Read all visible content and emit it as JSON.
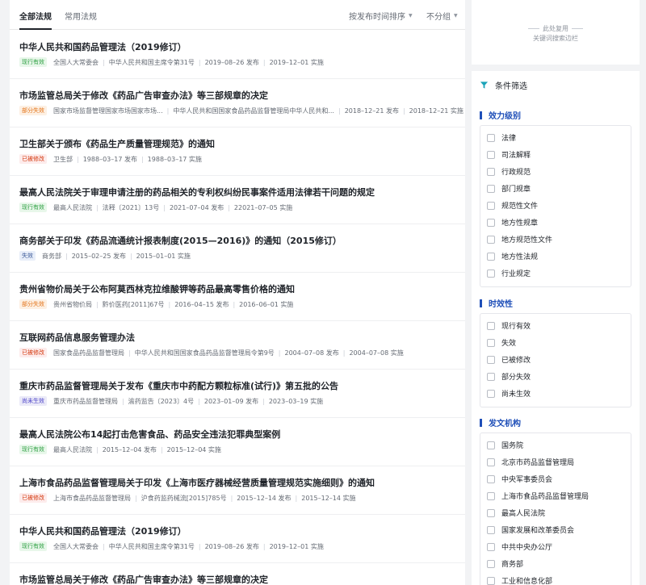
{
  "tabs": [
    {
      "label": "全部法规"
    },
    {
      "label": "常用法规"
    }
  ],
  "sort": {
    "time_label": "按发布时间排序",
    "group_label": "不分组"
  },
  "items": [
    {
      "title": "中华人民共和国药品管理法（2019修订）",
      "badge": "现行有效",
      "status": "valid",
      "meta": [
        "全国人大常委会",
        "中华人民共和国主席令第31号",
        "2019–08–26 发布",
        "2019–12–01 实施"
      ]
    },
    {
      "title": "市场监管总局关于修改《药品广告审查办法》等三部规章的决定",
      "badge": "部分失效",
      "status": "partial",
      "meta": [
        "国家市场监督管理国家市场国家市场...",
        "中华人民共和国国家食品药品监督管理局中华人民共和...",
        "2018–12–21 发布",
        "2018–12–21 实施"
      ]
    },
    {
      "title": "卫生部关于颁布《药品生产质量管理规范》的通知",
      "badge": "已被修改",
      "status": "amended",
      "meta": [
        "卫生部",
        "1988–03–17 发布",
        "1988–03–17 实施"
      ]
    },
    {
      "title": "最高人民法院关于审理申请注册的药品相关的专利权纠纷民事案件适用法律若干问题的规定",
      "badge": "现行有效",
      "status": "valid",
      "meta": [
        "最高人民法院",
        "法释〔2021〕13号",
        "2021–07–04 发布",
        "22021–07–05 实施"
      ]
    },
    {
      "title": "商务部关于印发《药品流通统计报表制度(2015—2016)》的通知（2015修订）",
      "badge": "失效",
      "status": "invalid",
      "meta": [
        "商务部",
        "2015–02–25 发布",
        "2015–01–01 实施"
      ]
    },
    {
      "title": "贵州省物价局关于公布阿莫西林克拉维酸钾等药品最高零售价格的通知",
      "badge": "部分失效",
      "status": "partial",
      "meta": [
        "贵州省物价局",
        "黔价医药[2011]67号",
        "2016–04–15 发布",
        "2016–06–01 实施"
      ]
    },
    {
      "title": "互联网药品信息服务管理办法",
      "badge": "已被修改",
      "status": "amended",
      "meta": [
        "国家食品药品监督管理局",
        "中华人民共和国国家食品药品监督管理局令第9号",
        "2004–07–08 发布",
        "2004–07–08 实施"
      ]
    },
    {
      "title": "重庆市药品监督管理局关于发布《重庆市中药配方颗粒标准(试行)》第五批的公告",
      "badge": "尚未生效",
      "status": "pending",
      "meta": [
        "重庆市药品监督管理局",
        "渝药监告〔2023〕4号",
        "2023–01–09 发布",
        "2023–03–19 实施"
      ]
    },
    {
      "title": "最高人民法院公布14起打击危害食品、药品安全违法犯罪典型案例",
      "badge": "现行有效",
      "status": "valid",
      "meta": [
        "最高人民法院",
        "2015–12–04 发布",
        "2015–12–04 实施"
      ]
    },
    {
      "title": "上海市食品药品监督管理局关于印发《上海市医疗器械经营质量管理规范实施细则》的通知",
      "badge": "已被修改",
      "status": "amended",
      "meta": [
        "上海市食品药品监督管理局",
        "沪食药监药械流[2015]785号",
        "2015–12–14 发布",
        "2015–12–14 实施"
      ]
    },
    {
      "title": "中华人民共和国药品管理法（2019修订）",
      "badge": "现行有效",
      "status": "valid",
      "meta": [
        "全国人大常委会",
        "中华人民共和国主席令第31号",
        "2019–08–26 发布",
        "2019–12–01 实施"
      ]
    },
    {
      "title": "市场监管总局关于修改《药品广告审查办法》等三部规章的决定",
      "badge": "",
      "status": "",
      "meta": []
    }
  ],
  "ad": {
    "line1": "此处复用",
    "line2": "关键词搜索边栏"
  },
  "filter": {
    "title": "条件筛选",
    "sections": [
      {
        "title": "效力级别",
        "options": [
          "法律",
          "司法解释",
          "行政规范",
          "部门规章",
          "规范性文件",
          "地方性规章",
          "地方规范性文件",
          "地方性法规",
          "行业规定"
        ]
      },
      {
        "title": "时效性",
        "options": [
          "现行有效",
          "失效",
          "已被修改",
          "部分失效",
          "尚未生效"
        ]
      },
      {
        "title": "发文机构",
        "options": [
          "国务院",
          "北京市药品监督管理局",
          "中央军事委员会",
          "上海市食品药品监督管理局",
          "最高人民法院",
          "国家发展和改革委员会",
          "中共中央办公厅",
          "商务部",
          "工业和信息化部"
        ]
      }
    ]
  }
}
